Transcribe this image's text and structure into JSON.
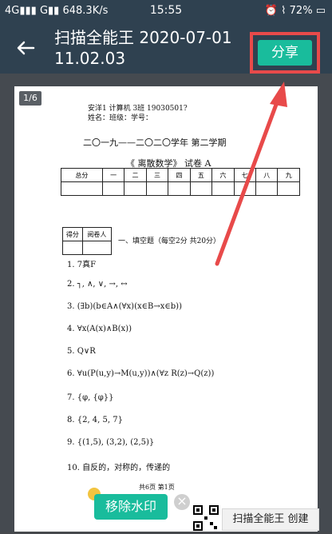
{
  "status": {
    "network": "4G",
    "carrier2": "G",
    "speed": "648.3K/s",
    "time": "15:55",
    "battery": "72%"
  },
  "appbar": {
    "title": "扫描全能王 2020-07-01 11.02.03",
    "share": "分享"
  },
  "page": {
    "indicator": "1/6",
    "header_handwriting": "安洋1 计算机 3班 19030501?",
    "info_line": "姓名：班级：学号：",
    "term": "二〇一九——二〇二〇学年    第二学期",
    "course": "《 离散数学》 试卷 A",
    "score_headers": [
      "总分",
      "一",
      "二",
      "三",
      "四",
      "五",
      "六",
      "七",
      "八",
      "九"
    ],
    "small_table_headers": [
      "得分",
      "阅卷人"
    ],
    "section": "一、填空题（每空2分 共20分）",
    "answers": [
      "1.  7真F",
      "2.  ┐, ∧, ∨, →, ↔",
      "3.  (∃b)(b∈A∧(∀x)(x∈B→x∈b))",
      "4.  ∀x(A(x)∧B(x))",
      "5.  Q∨R",
      "6.  ∀u(P(u,y)→M(u,y))∧(∀z R(z)→Q(z))",
      "7.  {φ, {φ}}",
      "8.  {2, 4, 5, 7}",
      "9.  {(1,5), (3,2), (2,5)}",
      "10.  自反的，对称的，传递的"
    ],
    "footer": "共6页 第1页"
  },
  "watermark": {
    "remove": "移除水印",
    "brand": "扫描全能王 创建"
  },
  "colors": {
    "accent": "#19bc9c",
    "highlight": "#e84a4a"
  }
}
